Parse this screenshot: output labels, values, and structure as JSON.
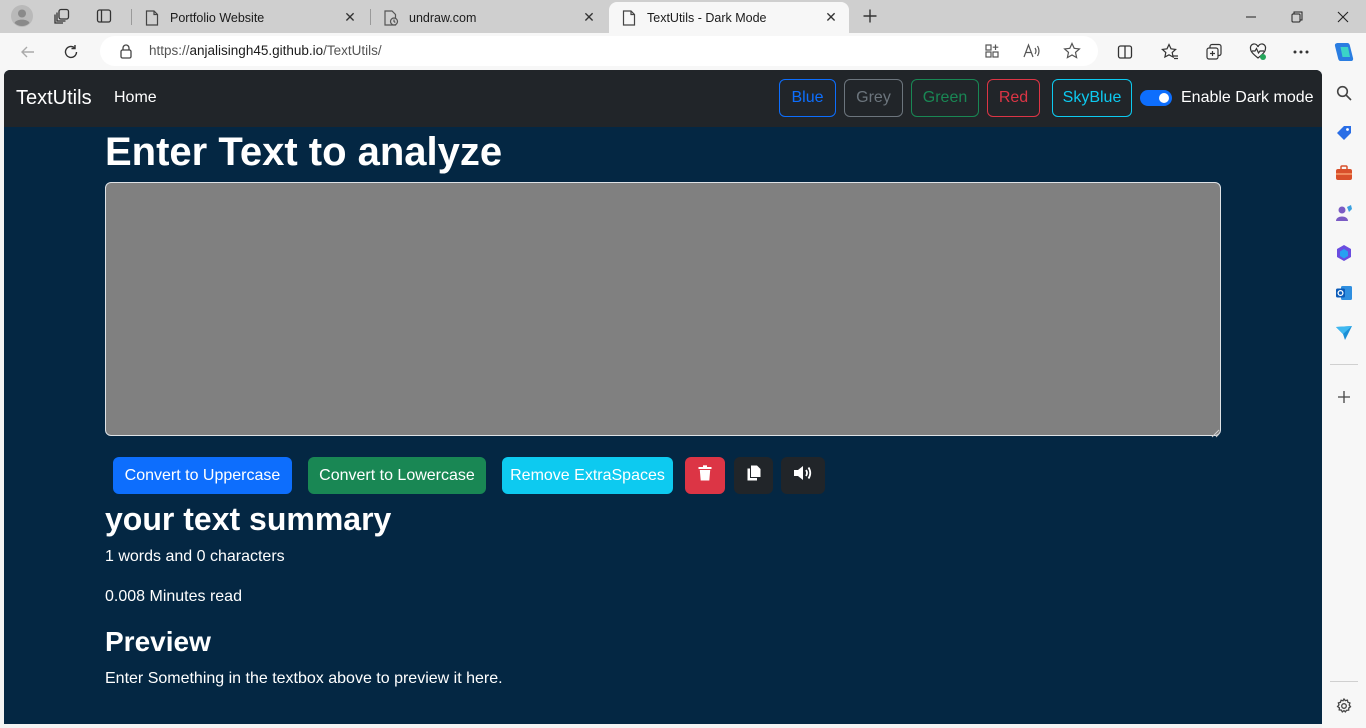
{
  "browser": {
    "tabs": [
      {
        "title": "Portfolio Website",
        "active": false
      },
      {
        "title": "undraw.com",
        "active": false
      },
      {
        "title": "TextUtils - Dark Mode",
        "active": true
      }
    ],
    "url_prefix": "https://",
    "url_host": "anjalisingh45.github.io",
    "url_path": "/TextUtils/"
  },
  "navbar": {
    "brand": "TextUtils",
    "home": "Home",
    "theme_buttons": [
      {
        "label": "Blue",
        "color": "#0d6efd"
      },
      {
        "label": "Grey",
        "color": "#6c757d"
      },
      {
        "label": "Green",
        "color": "#198754"
      },
      {
        "label": "Red",
        "color": "#dc3545"
      },
      {
        "label": "SkyBlue",
        "color": "#0dcaf0"
      }
    ],
    "dark_mode_label": "Enable Dark mode",
    "dark_mode_enabled": true
  },
  "main": {
    "heading": "Enter Text to analyze",
    "textarea_value": "",
    "buttons": {
      "uppercase": "Convert to Uppercase",
      "lowercase": "Convert to Lowercase",
      "extraspaces": "Remove ExtraSpaces",
      "delete_icon": "trash-icon",
      "copy_icon": "copy-icon",
      "speak_icon": "volume-icon"
    },
    "summary_heading": "your text summary",
    "word_count_text": "1 words and 0 characters",
    "read_time_text": "0.008 Minutes read",
    "preview_heading": "Preview",
    "preview_text": "Enter Something in the textbox above to preview it here."
  },
  "colors": {
    "page_bg": "#042743",
    "navbar_bg": "#212529",
    "textarea_bg": "#808080",
    "primary": "#0d6efd",
    "success": "#198754",
    "info": "#0dcaf0",
    "danger": "#dc3545",
    "dark": "#212529"
  }
}
